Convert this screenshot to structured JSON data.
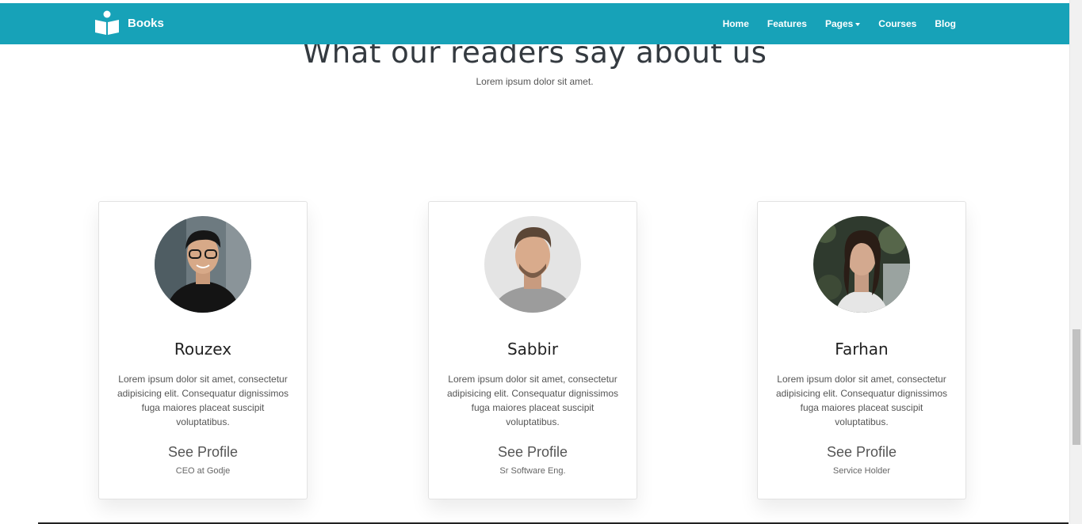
{
  "navbar": {
    "brand": "Books",
    "links": [
      {
        "label": "Home"
      },
      {
        "label": "Features"
      },
      {
        "label": "Pages",
        "dropdown": true
      },
      {
        "label": "Courses"
      },
      {
        "label": "Blog"
      }
    ],
    "color": "#17a2b8"
  },
  "section": {
    "title": "What our readers say about us",
    "subtitle": "Lorem ipsum dolor sit amet."
  },
  "cards": [
    {
      "name": "Rouzex",
      "text": "Lorem ipsum dolor sit amet, consectetur adipisicing elit. Consequatur dignissimos fuga maiores placeat suscipit voluptatibus.",
      "link": "See Profile",
      "role": "CEO at Godje"
    },
    {
      "name": "Sabbir",
      "text": "Lorem ipsum dolor sit amet, consectetur adipisicing elit. Consequatur dignissimos fuga maiores placeat suscipit voluptatibus.",
      "link": "See Profile",
      "role": "Sr Software Eng."
    },
    {
      "name": "Farhan",
      "text": "Lorem ipsum dolor sit amet, consectetur adipisicing elit. Consequatur dignissimos fuga maiores placeat suscipit voluptatibus.",
      "link": "See Profile",
      "role": "Service Holder"
    }
  ]
}
